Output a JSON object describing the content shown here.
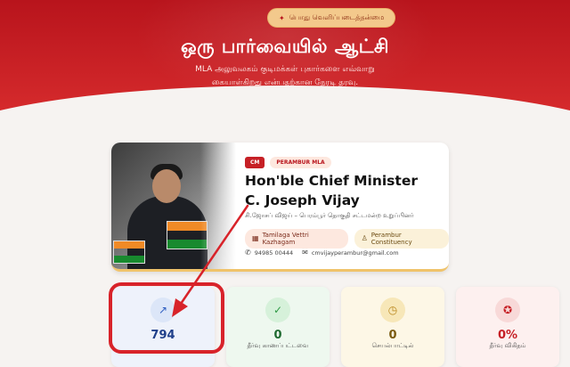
{
  "hero": {
    "pill": "பொது வெளிப்படைத்தன்மை",
    "title": "ஒரு பார்வையில் ஆட்சி",
    "subtitle_line1": "MLA அலுவலகம் குடிமக்கள் புகார்களை எவ்வாறு",
    "subtitle_line2": "கையாள்கிறது என்பதற்கான நேரடி தரவு."
  },
  "profile": {
    "badge_cm": "CM",
    "badge_constituency": "PERAMBUR MLA",
    "name_line1": "Hon'ble Chief Minister",
    "name_line2": "C. Joseph Vijay",
    "tamil_subtitle": "சி.ஜோசப் விஜய் – பெரம்பூர் தொகுதி சட்டமன்ற உறுப்பினர்",
    "party": "Tamilaga Vettri Kazhagam",
    "constituency": "Perambur Constituency",
    "phone": "94985 00444",
    "email": "cmvijayperambur@gmail.com",
    "icons": {
      "party": "party-icon",
      "constituency": "person-icon",
      "phone": "phone-icon",
      "email": "mail-icon"
    }
  },
  "stats": [
    {
      "value": "794",
      "label": "",
      "icon": "trend-up-icon",
      "color": "#2f5fc1"
    },
    {
      "value": "0",
      "label": "தீர்வு காணப்பட்டவை",
      "icon": "check-circle-icon",
      "color": "#2e9a45"
    },
    {
      "value": "0",
      "label": "செயல்பாட்டில்",
      "icon": "clock-icon",
      "color": "#b9861a"
    },
    {
      "value": "0%",
      "label": "தீர்வு விகிதம்",
      "icon": "award-icon",
      "color": "#c62026"
    }
  ],
  "colors": {
    "hero_red": "#c62026",
    "accent_gold": "#f0c36a",
    "annotation_red": "#d8232a"
  }
}
